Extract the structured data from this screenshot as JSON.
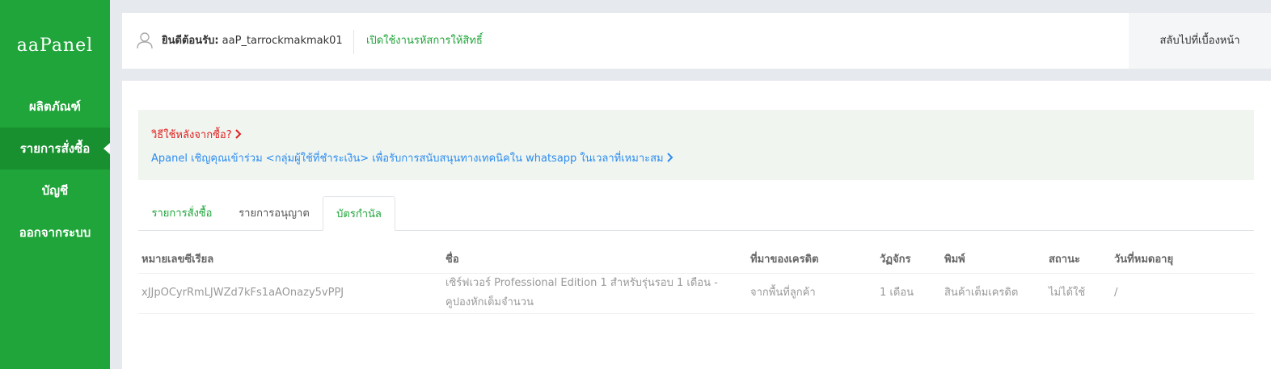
{
  "sidebar": {
    "logo": "aaPanel",
    "items": [
      {
        "label": "ผลิตภัณฑ์"
      },
      {
        "label": "รายการสั่งซื้อ"
      },
      {
        "label": "บัญชี"
      },
      {
        "label": "ออกจากระบบ"
      }
    ]
  },
  "header": {
    "welcome_label": "ยินดีต้อนรับ:",
    "username": "aaP_tarrockmakmak01",
    "auth_link": "เปิดใช้งานรหัสการให้สิทธิ์",
    "home_link": "สลับไปที่เบื้องหน้า"
  },
  "notice": {
    "line1": "วิธีใช้หลังจากซื้อ?",
    "line2": "Apanel เชิญคุณเข้าร่วม <กลุ่มผู้ใช้ที่ชำระเงิน> เพื่อรับการสนับสนุนทางเทคนิคใน whatsapp ในเวลาที่เหมาะสม"
  },
  "tabs": [
    {
      "label": "รายการสั่งซื้อ"
    },
    {
      "label": "รายการอนุญาต"
    },
    {
      "label": "บัตรกำนัล"
    }
  ],
  "table": {
    "headers": [
      "หมายเลขซีเรียล",
      "ชื่อ",
      "ที่มาของเครดิต",
      "วัฏจักร",
      "พิมพ์",
      "สถานะ",
      "วันที่หมดอายุ"
    ],
    "rows": [
      {
        "serial": "xJJpOCyrRmLJWZd7kFs1aAOnazy5vPPJ",
        "name": "เซิร์ฟเวอร์ Professional Edition 1 สำหรับรุ่นรอบ 1 เดือน - คูปองหักเต็มจำนวน",
        "source": "จากพื้นที่ลูกค้า",
        "cycle": "1 เดือน",
        "type": "สินค้าเต็มเครดิต",
        "status": "ไม่ได้ใช้",
        "expiry": "/"
      }
    ]
  },
  "colors": {
    "brand_green": "#20a53a",
    "active_nav": "#18902f",
    "notice_red": "#e02020",
    "link_blue": "#2d8cf0"
  },
  "icons": {
    "user": "user-icon",
    "chevron": "chevron-right-icon"
  }
}
